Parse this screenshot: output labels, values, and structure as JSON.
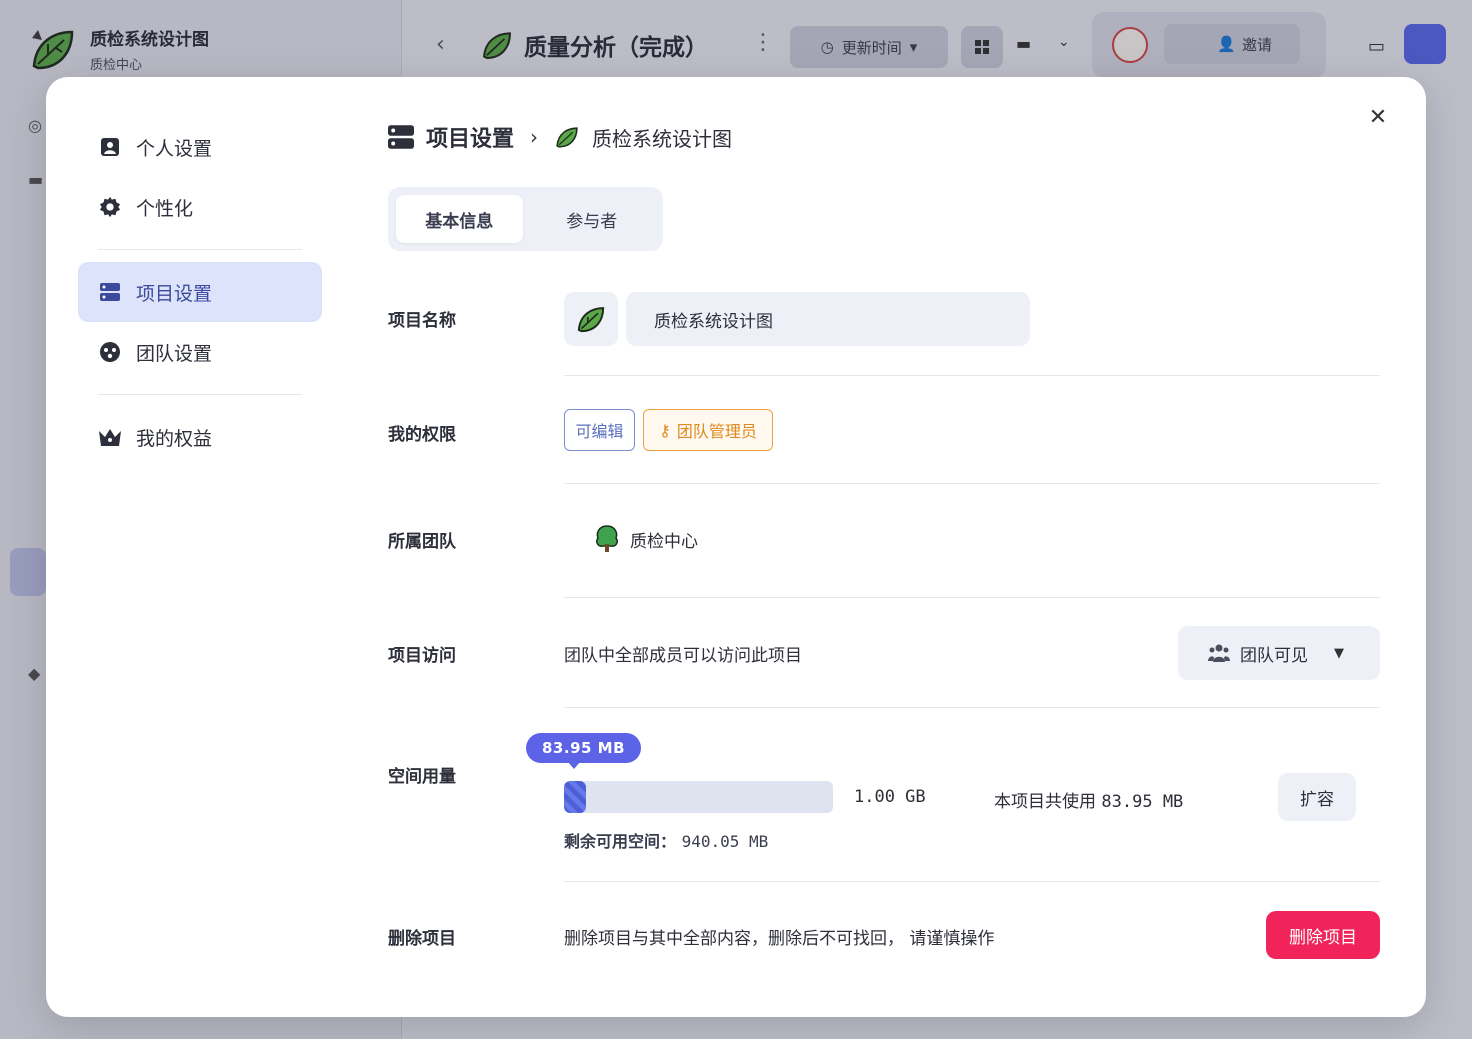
{
  "background": {
    "project_title": "质检系统设计图",
    "project_team": "质检中心",
    "doc_title": "质量分析（完成）",
    "sort_label": "更新时间",
    "invite_label": "邀请"
  },
  "modal": {
    "nav": {
      "items": [
        {
          "label": "个人设置",
          "icon": "id-card-icon"
        },
        {
          "label": "个性化",
          "icon": "gear-icon"
        },
        {
          "label": "项目设置",
          "icon": "server-icon"
        },
        {
          "label": "团队设置",
          "icon": "team-face-icon"
        },
        {
          "label": "我的权益",
          "icon": "crown-icon"
        }
      ],
      "active_index": 2
    },
    "breadcrumb": {
      "section": "项目设置",
      "project": "质检系统设计图"
    },
    "tabs": [
      {
        "label": "基本信息",
        "active": true
      },
      {
        "label": "参与者",
        "active": false
      }
    ],
    "fields": {
      "name": {
        "label": "项目名称",
        "value": "质检系统设计图"
      },
      "permission": {
        "label": "我的权限",
        "tags": [
          "可编辑",
          "团队管理员"
        ]
      },
      "team": {
        "label": "所属团队",
        "value": "质检中心"
      },
      "access": {
        "label": "项目访问",
        "description": "团队中全部成员可以访问此项目",
        "selected": "团队可见"
      },
      "storage": {
        "label": "空间用量",
        "used_badge": "83.95 MB",
        "total": "1.00 GB",
        "used_prefix": "本项目共使用",
        "used_value": "83.95 MB",
        "remaining_label": "剩余可用空间：",
        "remaining_value": "940.05 MB",
        "used_fraction": 0.082,
        "expand_label": "扩容"
      },
      "delete": {
        "label": "删除项目",
        "description": "删除项目与其中全部内容，删除后不可找回， 请谨慎操作",
        "button": "删除项目"
      }
    }
  },
  "colors": {
    "accent": "#5c63e6",
    "danger": "#f0245a",
    "admin": "#e08a20",
    "active_nav": "#dde3fb"
  }
}
